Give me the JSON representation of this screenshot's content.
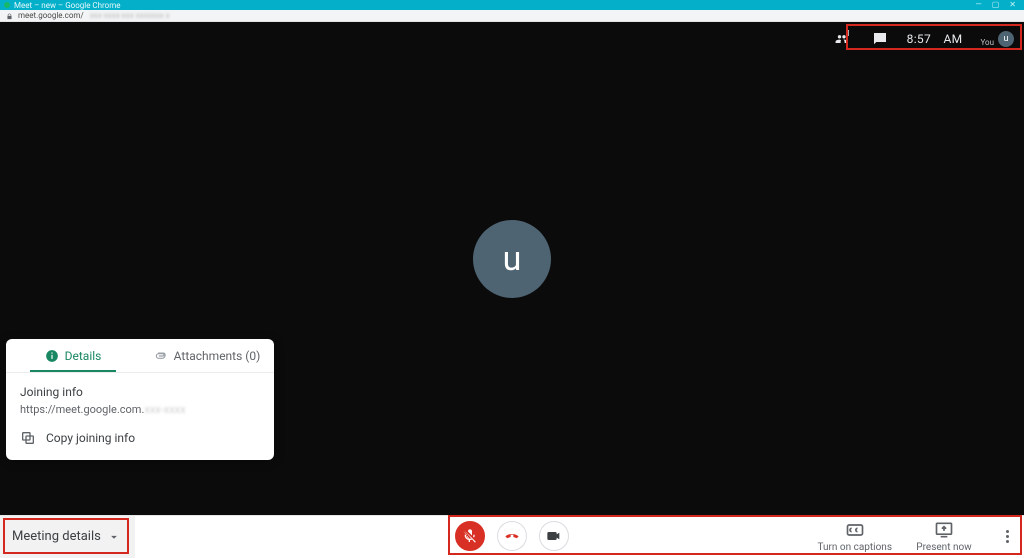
{
  "window": {
    "title": "Meet – new – Google Chrome",
    "url_prefix": "meet.google.com/"
  },
  "stage": {
    "time": "8:57 AM",
    "you_label": "You",
    "avatar_letter": "u",
    "participants_count": "1"
  },
  "details": {
    "tab_details": "Details",
    "tab_attachments": "Attachments (0)",
    "joining_info_label": "Joining info",
    "joining_link_prefix": "https://meet.google.com.",
    "copy_label": "Copy joining info"
  },
  "bottom": {
    "meeting_details": "Meeting details",
    "captions": "Turn on captions",
    "present": "Present now"
  }
}
